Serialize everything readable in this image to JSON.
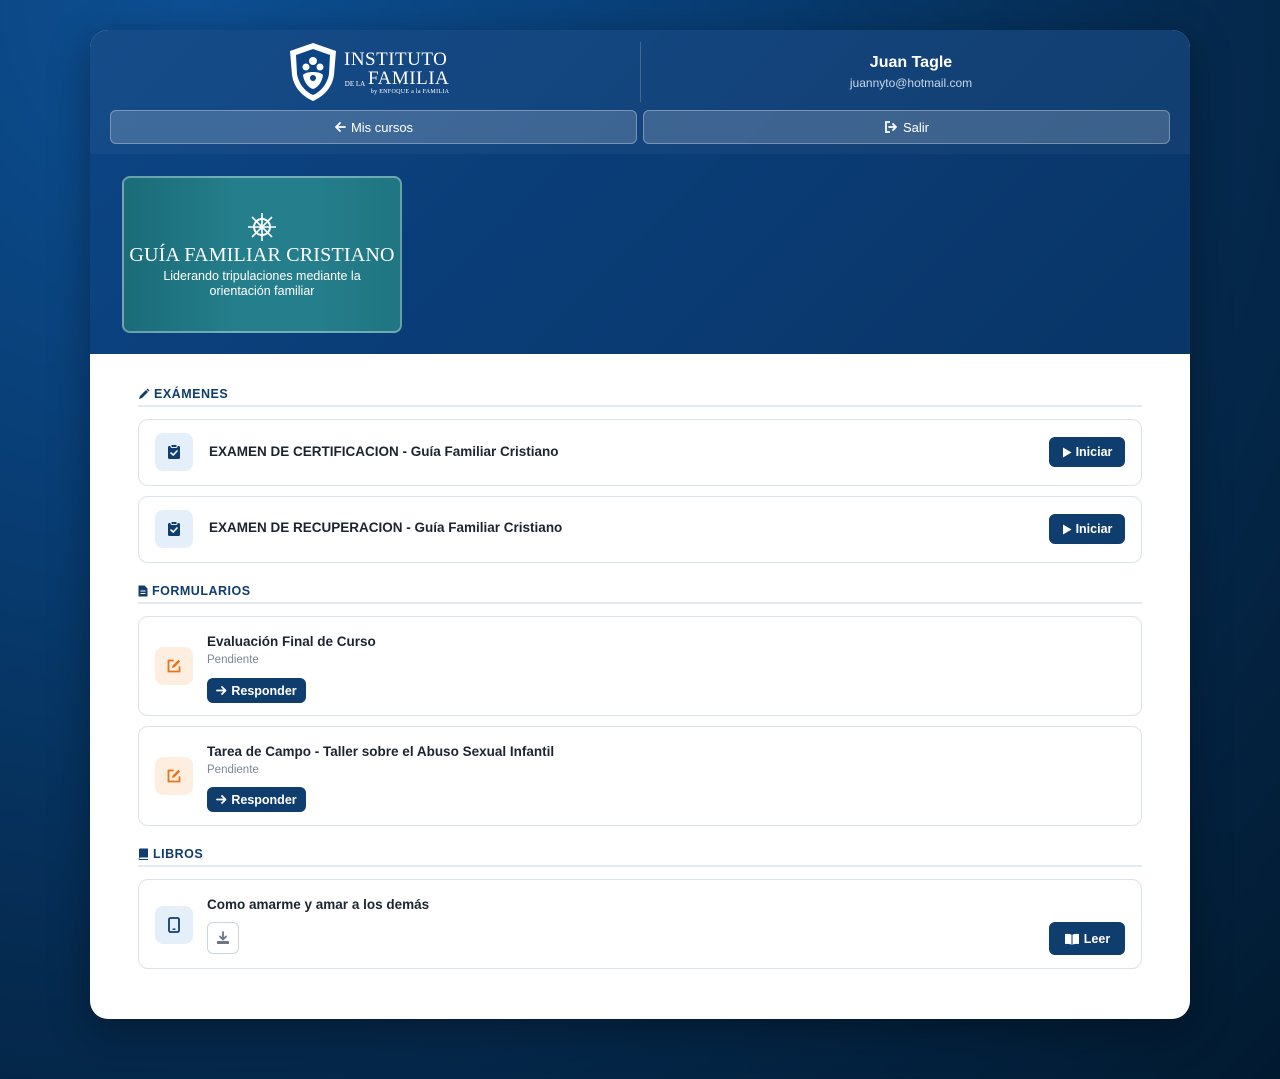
{
  "brand": {
    "line1": "INSTITUTO",
    "line2_small": "DE LA",
    "line2": "FAMILIA",
    "line3": "by ENFOQUE a la FAMILIA"
  },
  "user": {
    "name": "Juan Tagle",
    "email": "juannyto@hotmail.com"
  },
  "nav": {
    "back_label": "Mis cursos",
    "logout_label": "Salir"
  },
  "course": {
    "title": "GUÍA FAMILIAR CRISTIANO",
    "subtitle_line1": "Liderando tripulaciones mediante la",
    "subtitle_line2": "orientación familiar"
  },
  "sections": {
    "exams": {
      "label": "EXÁMENES",
      "items": [
        {
          "title": "EXAMEN DE CERTIFICACION - Guía Familiar Cristiano",
          "action": "Iniciar"
        },
        {
          "title": "EXAMEN DE RECUPERACION - Guía Familiar Cristiano",
          "action": "Iniciar"
        }
      ]
    },
    "forms": {
      "label": "FORMULARIOS",
      "items": [
        {
          "title": "Evaluación Final de Curso",
          "status": "Pendiente",
          "action": "Responder"
        },
        {
          "title": "Tarea de Campo - Taller sobre el Abuso Sexual Infantil",
          "status": "Pendiente",
          "action": "Responder"
        }
      ]
    },
    "books": {
      "label": "LIBROS",
      "items": [
        {
          "title": "Como amarme y amar a los demás",
          "action": "Leer"
        }
      ]
    }
  },
  "colors": {
    "primary": "#0f3e6e",
    "accent_orange": "#e8741a",
    "hero_blue": "#0c4585"
  }
}
